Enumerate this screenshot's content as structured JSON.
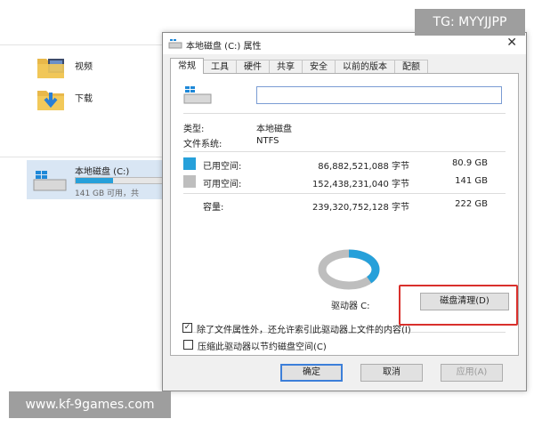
{
  "explorer": {
    "folders": [
      {
        "label": "视频",
        "icon": "video-folder-icon"
      },
      {
        "label": "下载",
        "icon": "download-folder-icon"
      }
    ],
    "drive": {
      "name": "本地磁盘 (C:)",
      "free_text": "141 GB 可用，共",
      "used_fraction": 0.4
    }
  },
  "dialog": {
    "title": "本地磁盘 (C:) 属性",
    "close": "✕",
    "tabs": [
      "常规",
      "工具",
      "硬件",
      "共享",
      "安全",
      "以前的版本",
      "配额"
    ],
    "active_tab": "常规",
    "name_value": "",
    "type_label": "类型:",
    "type_value": "本地磁盘",
    "fs_label": "文件系统:",
    "fs_value": "NTFS",
    "used": {
      "label": "已用空间:",
      "bytes": "86,882,521,088 字节",
      "size": "80.9 GB",
      "color": "#26a0da"
    },
    "free": {
      "label": "可用空间:",
      "bytes": "152,438,231,040 字节",
      "size": "141 GB",
      "color": "#bebebe"
    },
    "capacity": {
      "label": "容量:",
      "bytes": "239,320,752,128 字节",
      "size": "222 GB"
    },
    "drive_label": "驱动器 C:",
    "cleanup_button": "磁盘清理(D)",
    "compress_label": "压缩此驱动器以节约磁盘空间(C)",
    "compress_checked": false,
    "index_label": "除了文件属性外，还允许索引此驱动器上文件的内容(I)",
    "index_checked": true,
    "buttons": {
      "ok": "确定",
      "cancel": "取消",
      "apply": "应用(A)"
    },
    "highlight_color": "#d9302c"
  },
  "overlays": {
    "tg": "TG: MYYJJPP",
    "site": "www.kf-9games.com"
  }
}
